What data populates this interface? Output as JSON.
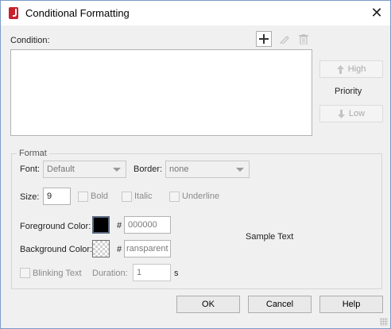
{
  "window": {
    "title": "Conditional Formatting",
    "close_glyph": "✕",
    "app_icon": "jreport-app-icon"
  },
  "condition": {
    "label": "Condition:",
    "items": [],
    "tools": [
      {
        "name": "add-condition-button",
        "icon": "plus-icon",
        "glyph": "＋",
        "enabled": true
      },
      {
        "name": "edit-condition-button",
        "icon": "pencil-icon",
        "glyph": "✎",
        "enabled": false
      },
      {
        "name": "delete-condition-button",
        "icon": "trash-icon",
        "glyph": "🗑",
        "enabled": false
      }
    ]
  },
  "priority": {
    "label": "Priority",
    "high_label": "High",
    "low_label": "Low",
    "high_enabled": false,
    "low_enabled": false
  },
  "format": {
    "legend": "Format",
    "font_label": "Font:",
    "font_value": "Default",
    "border_label": "Border:",
    "border_value": "none",
    "size_label": "Size:",
    "size_value": "9",
    "bold_label": "Bold",
    "bold_checked": false,
    "italic_label": "Italic",
    "italic_checked": false,
    "underline_label": "Underline",
    "underline_checked": false,
    "foreground_label": "Foreground Color:",
    "foreground_color": "#000000",
    "foreground_hash": "#",
    "foreground_value": "000000",
    "background_label": "Background Color:",
    "background_hash": "#",
    "background_value": "Transparent",
    "background_value_visible": "ransparent",
    "sample_text": "Sample Text",
    "blinking_label": "Blinking Text",
    "blinking_checked": false,
    "duration_label": "Duration:",
    "duration_value": "1",
    "duration_unit": "s"
  },
  "buttons": {
    "ok": "OK",
    "cancel": "Cancel",
    "help": "Help"
  }
}
